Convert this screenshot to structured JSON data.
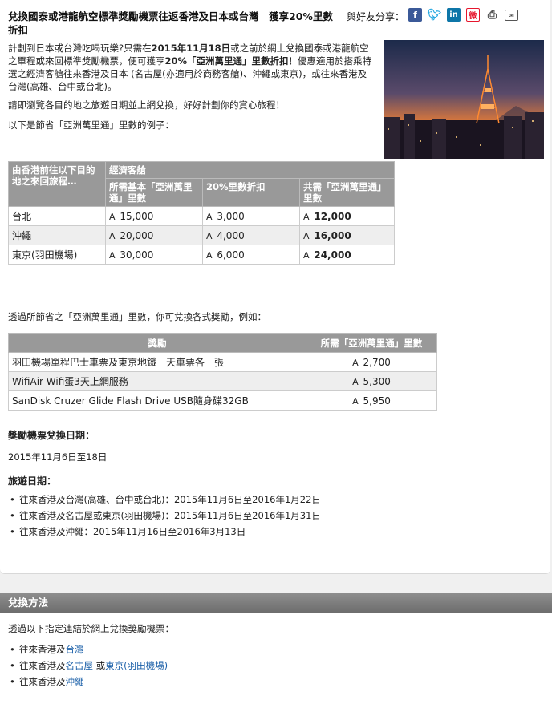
{
  "header": {
    "title": "兌換國泰或港龍航空標準獎勵機票往返香港及日本或台灣　獲享20%里數折扣",
    "share_label": "與好友分享：",
    "share_icons": [
      "facebook-icon",
      "twitter-icon",
      "linkedin-icon",
      "weibo-icon",
      "print-icon",
      "email-icon"
    ]
  },
  "intro": {
    "p1_a": "計劃到日本或台灣吃喝玩樂?只需在",
    "p1_b": "2015年11月18日",
    "p1_c": "或之前於網上兌換國泰或港龍航空之單程或來回標準獎勵機票，便可獲享",
    "p1_d": "20%「亞洲萬里通」里數折扣",
    "p1_e": "！優惠適用於搭乘特選之經濟客艙往來香港及日本 (名古屋(亦適用於商務客艙)、沖繩或東京)，或往來香港及台灣(高雄、台中或台北)。",
    "p2": "請即瀏覽各目的地之旅遊日期並上網兌換，好好計劃你的賞心旅程！",
    "p3": "以下是節省「亞洲萬里通」里數的例子："
  },
  "table1": {
    "h_route": "由香港前往以下目的地之來回旅程…",
    "h_class": "經濟客艙",
    "h_base": "所需基本「亞洲萬里通」里數",
    "h_discount": "20%里數折扣",
    "h_total": "共需「亞洲萬里通」里數",
    "mile_symbol": "A",
    "rows": [
      {
        "dest": "台北",
        "base": "15,000",
        "discount": "3,000",
        "total": "12,000"
      },
      {
        "dest": "沖繩",
        "base": "20,000",
        "discount": "4,000",
        "total": "16,000"
      },
      {
        "dest": "東京(羽田機場)",
        "base": "30,000",
        "discount": "6,000",
        "total": "24,000"
      }
    ]
  },
  "rewards_intro": "透過所節省之「亞洲萬里通」里數，你可兌換各式獎勵，例如：",
  "table2": {
    "h_reward": "獎勵",
    "h_miles": "所需「亞洲萬里通」里數",
    "rows": [
      {
        "reward": "羽田機場單程巴士車票及東京地鐵一天車票各一張",
        "miles": "2,700"
      },
      {
        "reward": "WifiAir Wifi蛋3天上網服務",
        "miles": "5,300"
      },
      {
        "reward": "SanDisk Cruzer Glide Flash Drive USB隨身碟32GB",
        "miles": "5,950"
      }
    ]
  },
  "redeem_period": {
    "heading": "獎勵機票兌換日期：",
    "text": "2015年11月6日至18日"
  },
  "travel_period": {
    "heading": "旅遊日期：",
    "items": [
      "往來香港及台灣(高雄、台中或台北)：2015年11月6日至2016年1月22日",
      "往來香港及名古屋或東京(羽田機場)：2015年11月6日至2016年1月31日",
      "往來香港及沖繩：2015年11月16日至2016年3月13日"
    ]
  },
  "how_to": {
    "bar_title": "兌換方法",
    "intro": "透過以下指定連結於網上兌換獎勵機票：",
    "prefix": "往來香港及",
    "link_taiwan": "台灣",
    "link_nagoya": "名古屋",
    "or_text": " 或",
    "link_tokyo": "東京(羽田機場)",
    "link_okinawa": "沖繩"
  }
}
